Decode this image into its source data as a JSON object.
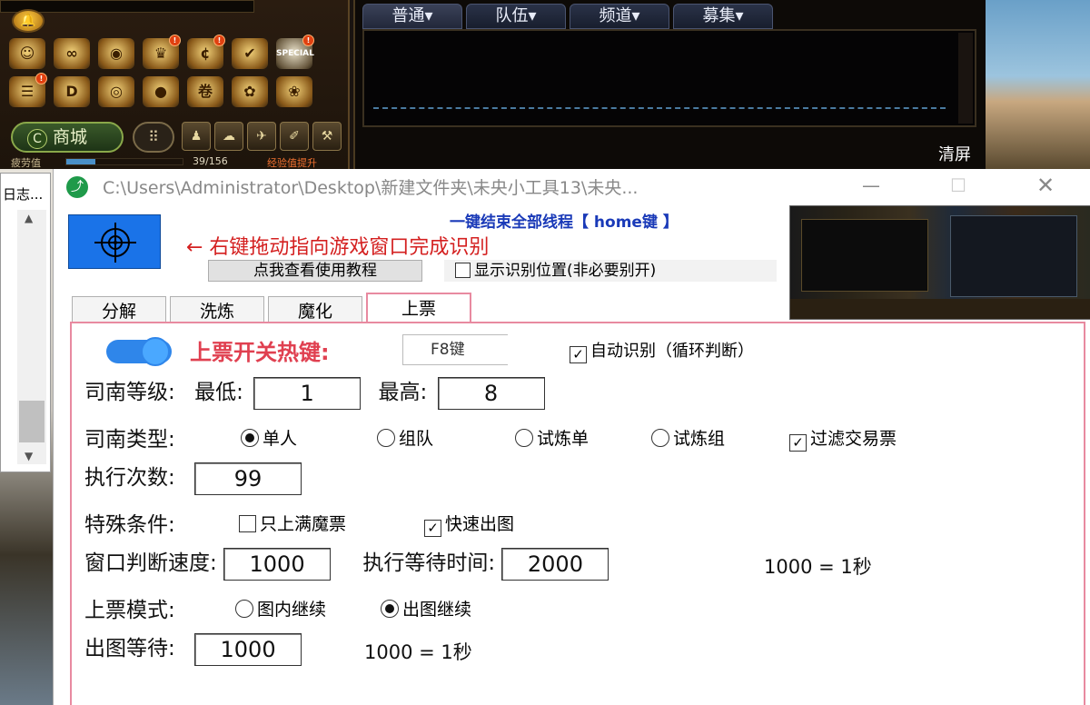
{
  "game": {
    "bell_icon": "bell-icon",
    "icons_row1": [
      {
        "name": "character-icon",
        "glyph": "☺",
        "badge": ""
      },
      {
        "name": "chain-link-icon",
        "glyph": "∞",
        "badge": ""
      },
      {
        "name": "eye-icon",
        "glyph": "◉",
        "badge": ""
      },
      {
        "name": "crown-icon",
        "glyph": "♛",
        "badge": "!"
      },
      {
        "name": "coin-c-icon",
        "glyph": "¢",
        "badge": "!"
      },
      {
        "name": "checklist-icon",
        "glyph": "✔",
        "badge": ""
      },
      {
        "name": "special-icon",
        "glyph": "SPECIAL",
        "badge": "!"
      }
    ],
    "icons_row2": [
      {
        "name": "notice-board-icon",
        "glyph": "☰",
        "badge": "!"
      },
      {
        "name": "daily-d-icon",
        "glyph": "D",
        "badge": ""
      },
      {
        "name": "ring-icon",
        "glyph": "◎",
        "badge": ""
      },
      {
        "name": "map-pin-icon",
        "glyph": "●",
        "badge": ""
      },
      {
        "name": "scroll-icon",
        "glyph": "卷",
        "badge": ""
      },
      {
        "name": "pet-icon",
        "glyph": "✿",
        "badge": ""
      },
      {
        "name": "mascot-icon",
        "glyph": "❀",
        "badge": ""
      }
    ],
    "shop_label": "商城",
    "small_icons": [
      "♟",
      "☁",
      "✈",
      "✐",
      "⚒"
    ],
    "fatigue_label": "疲劳值",
    "fatigue_value": "39/156",
    "fatigue_fraction": 0.25,
    "exp_boost": "经验值提升",
    "chat_tabs": [
      "普通▾",
      "队伍▾",
      "频道▾",
      "募集▾"
    ],
    "clear_label": "清屏"
  },
  "log_window": {
    "title_fragment": "日志..."
  },
  "window": {
    "title": "C:\\Users\\Administrator\\Desktop\\新建文件夹\\未央小工具13\\未央...",
    "min_glyph": "—",
    "max_glyph": "☐",
    "close_glyph": "✕",
    "hint": "←  右键拖动指向游戏窗口完成识别",
    "end_all": "一键结束全部线程【 home键 】",
    "tutorial_button": "点我查看使用教程",
    "show_position_label": "显示识别位置(非必要别开)",
    "show_position_checked": false,
    "tabs": [
      "分解",
      "洗炼",
      "魔化",
      "上票"
    ],
    "active_tab": 3
  },
  "panel": {
    "toggle_on": true,
    "hotkey_label": "上票开关热键:",
    "hotkey_value": "F8键",
    "auto_detect_label": "自动识别（循环判断）",
    "auto_detect_checked": true,
    "level_label": "司南等级:",
    "level_min_label": "最低:",
    "level_min": "1",
    "level_max_label": "最高:",
    "level_max": "8",
    "type_label": "司南类型:",
    "type_options": [
      "单人",
      "组队",
      "试炼单",
      "试炼组"
    ],
    "type_selected": 0,
    "filter_trade_label": "过滤交易票",
    "filter_trade_checked": true,
    "exec_count_label": "执行次数:",
    "exec_count": "99",
    "special_label": "特殊条件:",
    "only_full_label": "只上满魔票",
    "only_full_checked": false,
    "fast_map_label": "快速出图",
    "fast_map_checked": true,
    "window_speed_label": "窗口判断速度:",
    "window_speed": "1000",
    "exec_wait_label": "执行等待时间:",
    "exec_wait": "2000",
    "ms_note_1": "1000  =  1秒",
    "mode_label": "上票模式:",
    "mode_options": [
      "图内继续",
      "出图继续"
    ],
    "mode_selected": 1,
    "exit_wait_label": "出图等待:",
    "exit_wait": "1000",
    "ms_note_2": "1000  =  1秒"
  }
}
